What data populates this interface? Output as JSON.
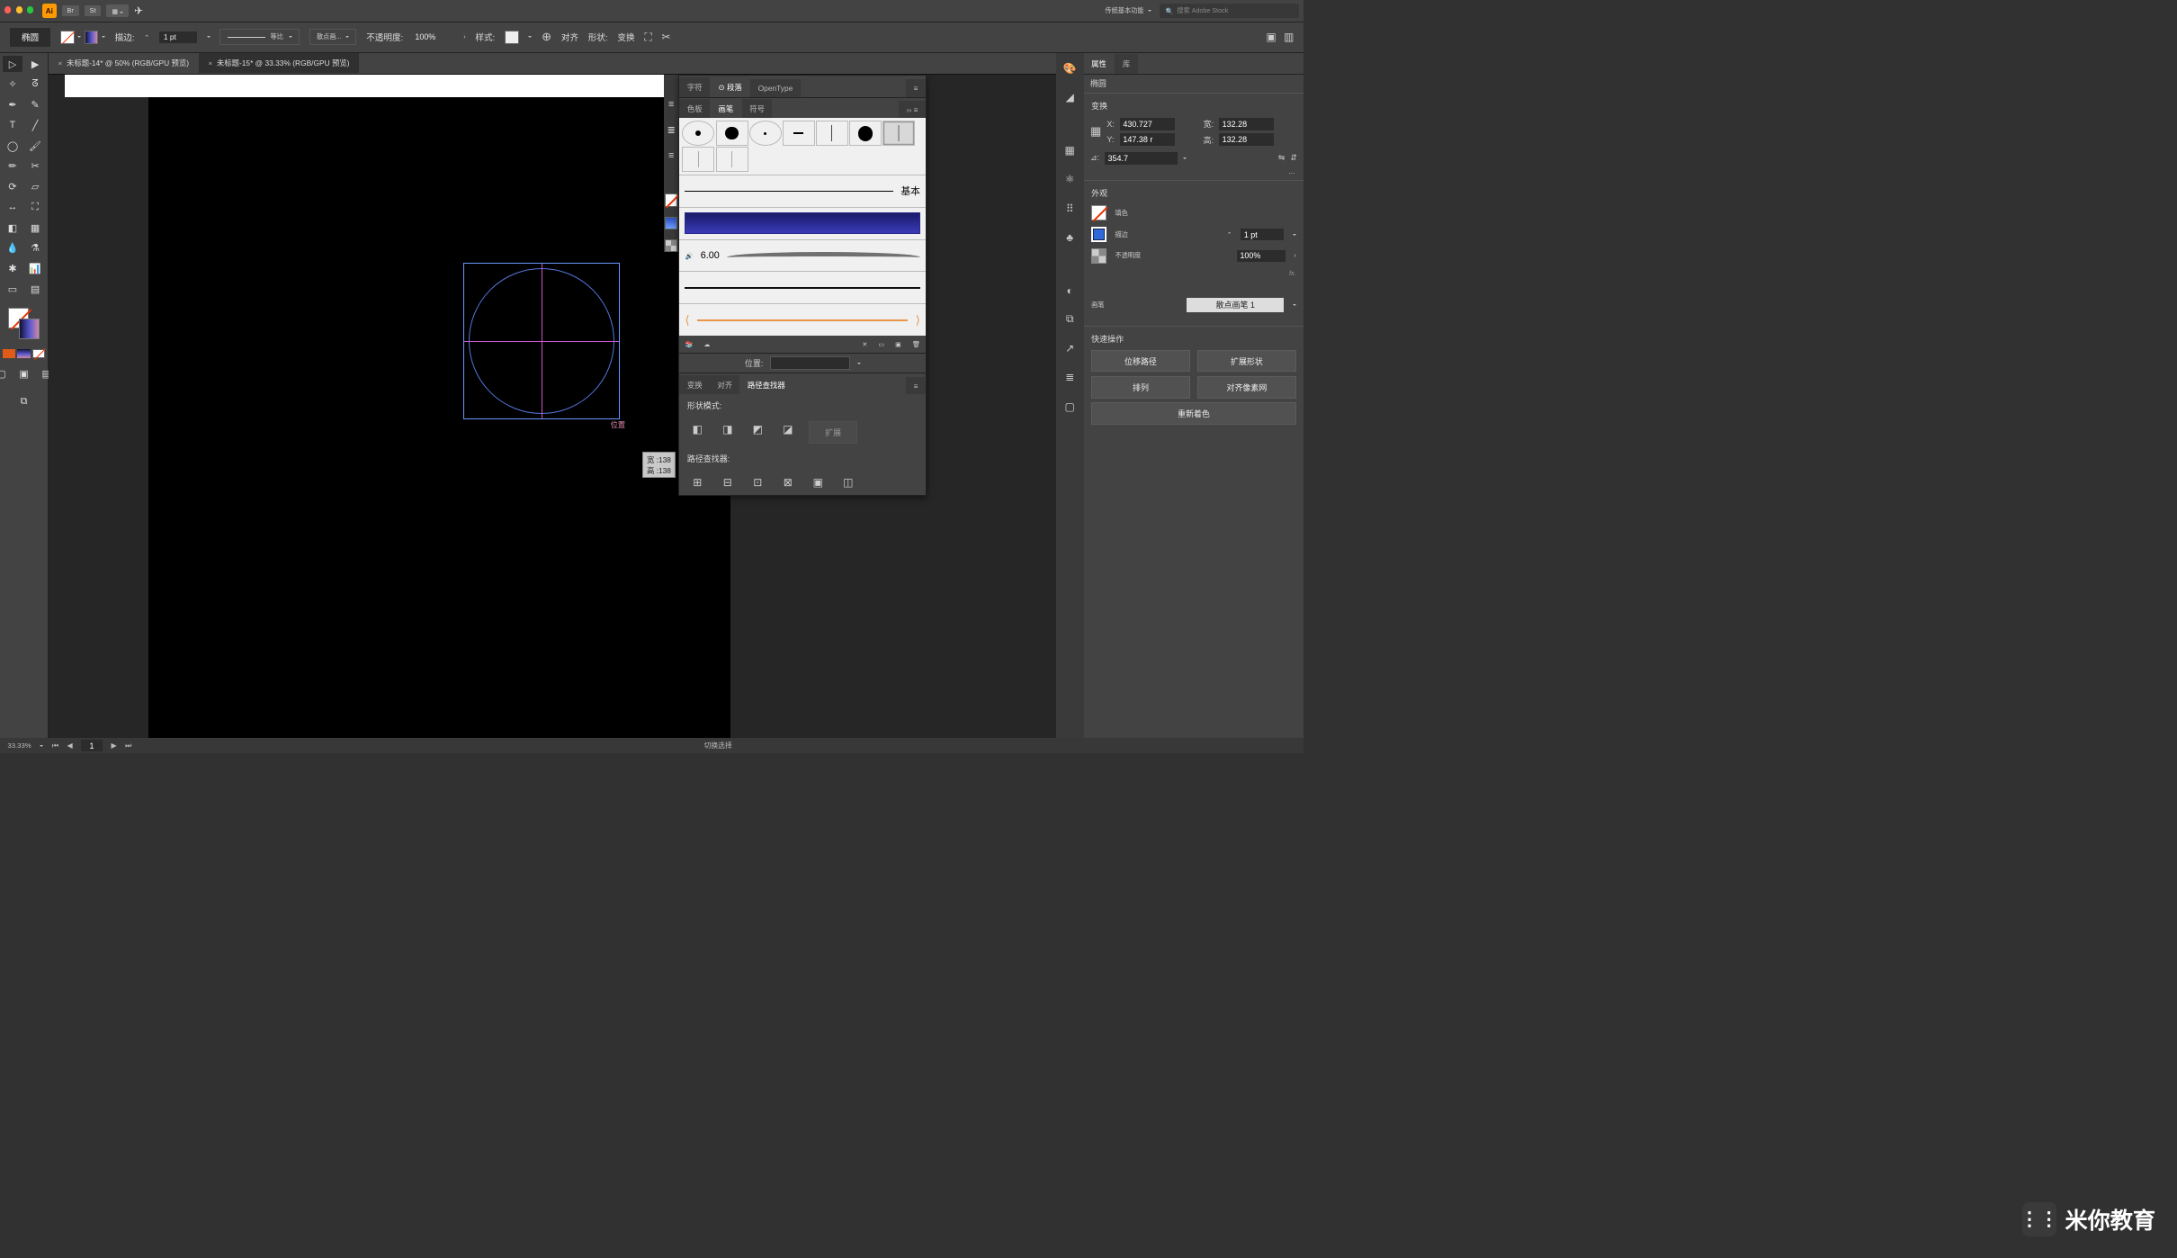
{
  "topbar": {
    "workspace": "传统基本功能",
    "search_placeholder": "搜索 Adobe Stock"
  },
  "control": {
    "shape_label": "椭圆",
    "stroke_label": "描边:",
    "stroke_value": "1 pt",
    "profile": "等比",
    "brush": "散点画...",
    "opacity_label": "不透明度:",
    "opacity_value": "100%",
    "style_label": "样式:",
    "align_label": "对齐",
    "shape_btn": "形状:",
    "transform_btn": "变换"
  },
  "docs": {
    "tab1": "未标题-14* @ 50% (RGB/GPU 预览)",
    "tab2": "未标题-15* @ 33.33% (RGB/GPU 预览)"
  },
  "canvas": {
    "pos_label": "位置",
    "tooltip_w": "宽 :138",
    "tooltip_h": "高 :138"
  },
  "typo_tabs": {
    "char": "字符",
    "para": "段落",
    "ot": "OpenType"
  },
  "brush_tabs": {
    "swatch": "色板",
    "brush": "画笔",
    "symbol": "符号"
  },
  "brush_panel": {
    "basic": "基本",
    "size": "6.00",
    "position": "位置:"
  },
  "pf_tabs": {
    "trans": "变换",
    "align": "对齐",
    "pf": "路径查找器"
  },
  "pf": {
    "shapemode": "形状模式:",
    "expand": "扩展",
    "pfLabel": "路径查找器:"
  },
  "props": {
    "tab_props": "属性",
    "tab_lib": "库",
    "sel_label": "椭圆",
    "transform": "变换",
    "x_label": "X:",
    "x": "430.727",
    "y_label": "Y:",
    "147.38 r": "147.38 r",
    "y": "147.38 r",
    "w_label": "宽:",
    "w": "132.28",
    "h_label": "高:",
    "h": "132.28",
    "ang_label": "⊿:",
    "ang": "354.7",
    "appearance": "外观",
    "fill": "填色",
    "stroke": "描边",
    "stroke_val": "1 pt",
    "opacity": "不透明度",
    "opacity_val": "100%",
    "brush_label": "画笔",
    "brush_val": "散点画笔 1",
    "quick": "快速操作",
    "offset": "位移路径",
    "expand": "扩展形状",
    "arrange": "排列",
    "pixel": "对齐像素网",
    "recolor": "重新着色"
  },
  "status": {
    "zoom": "33.33%",
    "page": "1",
    "mode": "切换选择"
  },
  "watermark": "米你教育"
}
